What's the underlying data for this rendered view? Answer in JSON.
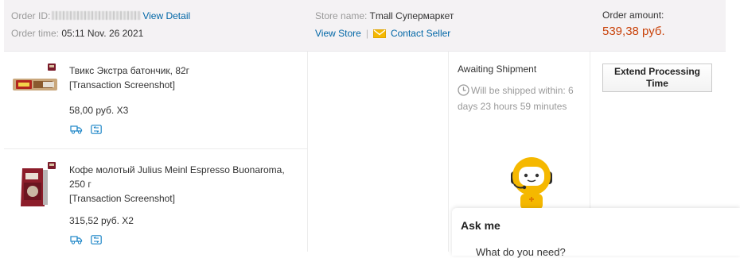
{
  "order": {
    "id_label": "Order ID:",
    "view_detail": "View Detail",
    "time_label": "Order time:",
    "time_value": "05:11 Nov. 26 2021",
    "store_label": "Store name:",
    "store_name": "Tmall Супермаркет",
    "view_store": "View Store",
    "separator": "|",
    "contact_seller": "Contact Seller",
    "amount_label": "Order amount:",
    "amount_value": "539,38 руб."
  },
  "products": [
    {
      "title": "Твикс Экстра батончик, 82г",
      "screenshot_link": "[Transaction Screenshot]",
      "price_qty": "58,00 руб. X3"
    },
    {
      "title_line1": "Кофе молотый Julius Meinl Espresso Buonaroma,",
      "title_line2": "250 г",
      "screenshot_link": "[Transaction Screenshot]",
      "price_qty": "315,52 руб. X2"
    }
  ],
  "status": {
    "title": "Awaiting Shipment",
    "wait_text": "Will be shipped within: 6 days 23 hours 59 minutes"
  },
  "actions": {
    "extend_processing": "Extend Processing Time"
  },
  "chat": {
    "title": "Ask me",
    "preview": "What do you need?"
  },
  "colors": {
    "link": "#0066a6",
    "amount": "#c9430b",
    "header_bg": "#f4f2f4",
    "robot": "#f5b800"
  }
}
